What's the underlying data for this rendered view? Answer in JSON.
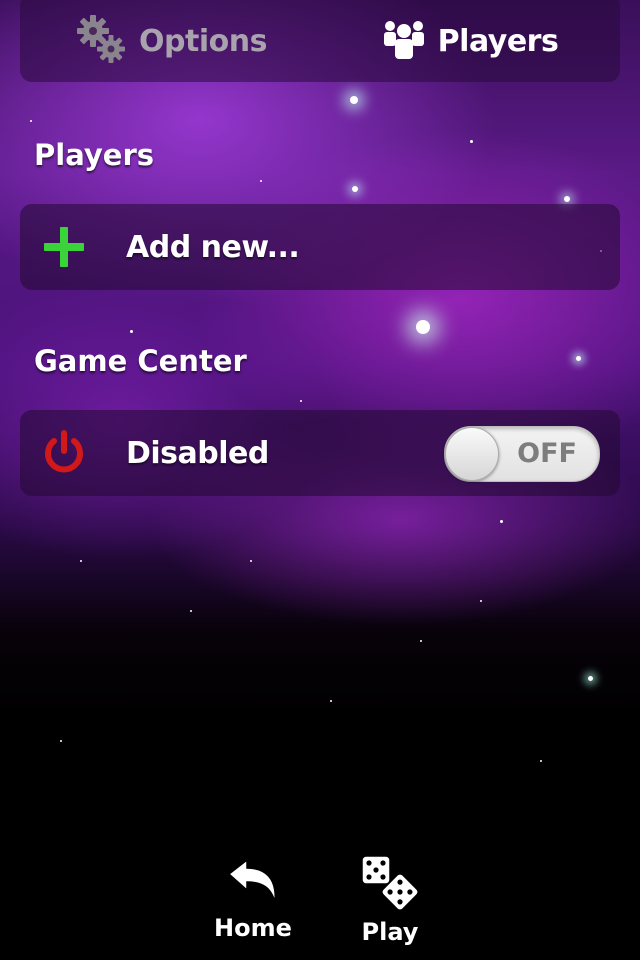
{
  "tabs": {
    "options_label": "Options",
    "players_label": "Players",
    "active": "Players"
  },
  "players_section": {
    "title": "Players",
    "add_label": "Add new..."
  },
  "game_center_section": {
    "title": "Game Center",
    "status_label": "Disabled",
    "toggle_text": "OFF",
    "toggle_on": false
  },
  "bottom_nav": {
    "home_label": "Home",
    "play_label": "Play"
  },
  "colors": {
    "plus_green": "#3ad43a",
    "power_red": "#d11919",
    "inactive_tab": "#a9a3ad"
  }
}
